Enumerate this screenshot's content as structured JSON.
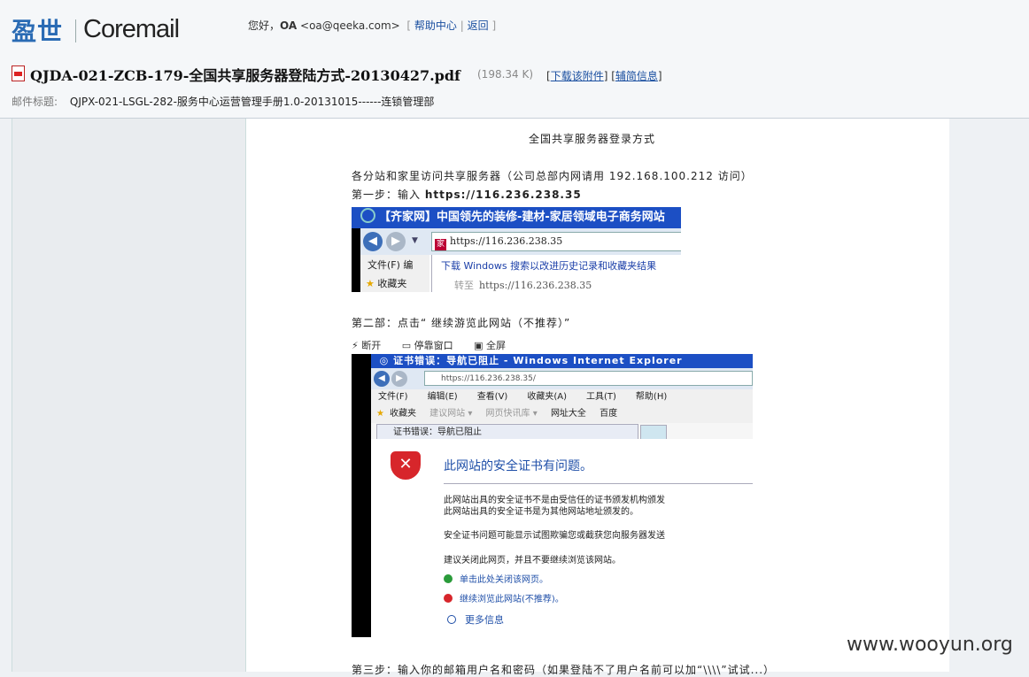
{
  "header": {
    "logo_cn": "盈世",
    "logo_en": "Coremail",
    "greeting_prefix": "您好，",
    "user_name": "OA",
    "user_email": "<oa@qeeka.com>",
    "help_link": "帮助中心",
    "back_link": "返回"
  },
  "attachment": {
    "file_name": "QJDA-021-ZCB-179-全国共享服务器登陆方式-20130427.pdf",
    "file_size": "(198.34 K)",
    "download_link": "下载该附件",
    "info_link": "辅简信息"
  },
  "subject": {
    "label": "邮件标题:",
    "value": "QJPX-021-LSGL-282-服务中心运营管理手册1.0-20131015------连锁管理部"
  },
  "document": {
    "title": "全国共享服务器登录方式",
    "line1": "各分站和家里访问共享服务器（公司总部内网请用 192.168.100.212 访问）",
    "step1_prefix": "第一步：输入",
    "step1_url": "https://116.236.238.35",
    "step2": "第二部：点击“ 继续游览此网站（不推荐）”",
    "step3": "第三步：输入你的邮箱用户名和密码（如果登陆不了用户名前可以加“\\\\\\\\”试试...）"
  },
  "screenshot1": {
    "title": "【齐家网】中国领先的装修-建材-家居领域电子商务网站",
    "fav_char": "家",
    "address": "https://116.236.238.35",
    "menu_file": "文件(F)  编",
    "favorites": "收藏夹",
    "suggest": "下载 Windows 搜索以改进历史记录和收藏夹结果",
    "goto_label": "转至",
    "goto_url": "https://116.236.238.35"
  },
  "toolbar2": {
    "disconnect": "断开",
    "pause": "停靠窗口",
    "fullscreen": "全屏"
  },
  "screenshot2": {
    "title": "证书错误：导航已阻止 - Windows Internet Explorer",
    "address": "https://116.236.238.35/",
    "menu": [
      "文件(F)",
      "编辑(E)",
      "查看(V)",
      "收藏夹(A)",
      "工具(T)",
      "帮助(H)"
    ],
    "favbar": [
      "收藏夹",
      "建议网站 ▾",
      "网页快讯库 ▾",
      "网址大全",
      "百度"
    ],
    "tab": "证书错误：导航已阻止",
    "heading": "此网站的安全证书有问题。",
    "p1": "此网站出具的安全证书不是由受信任的证书颁发机构颁发",
    "p2": "此网站出具的安全证书是为其他网站地址颁发的。",
    "p3": "安全证书问题可能显示试图欺骗您或截获您向服务器发送",
    "p4": "建议关闭此网页，并且不要继续浏览该网站。",
    "link_close": "单击此处关闭该网页。",
    "link_continue": "继续浏览此网站(不推荐)。",
    "link_more": "更多信息"
  },
  "watermark": "www.wooyun.org"
}
